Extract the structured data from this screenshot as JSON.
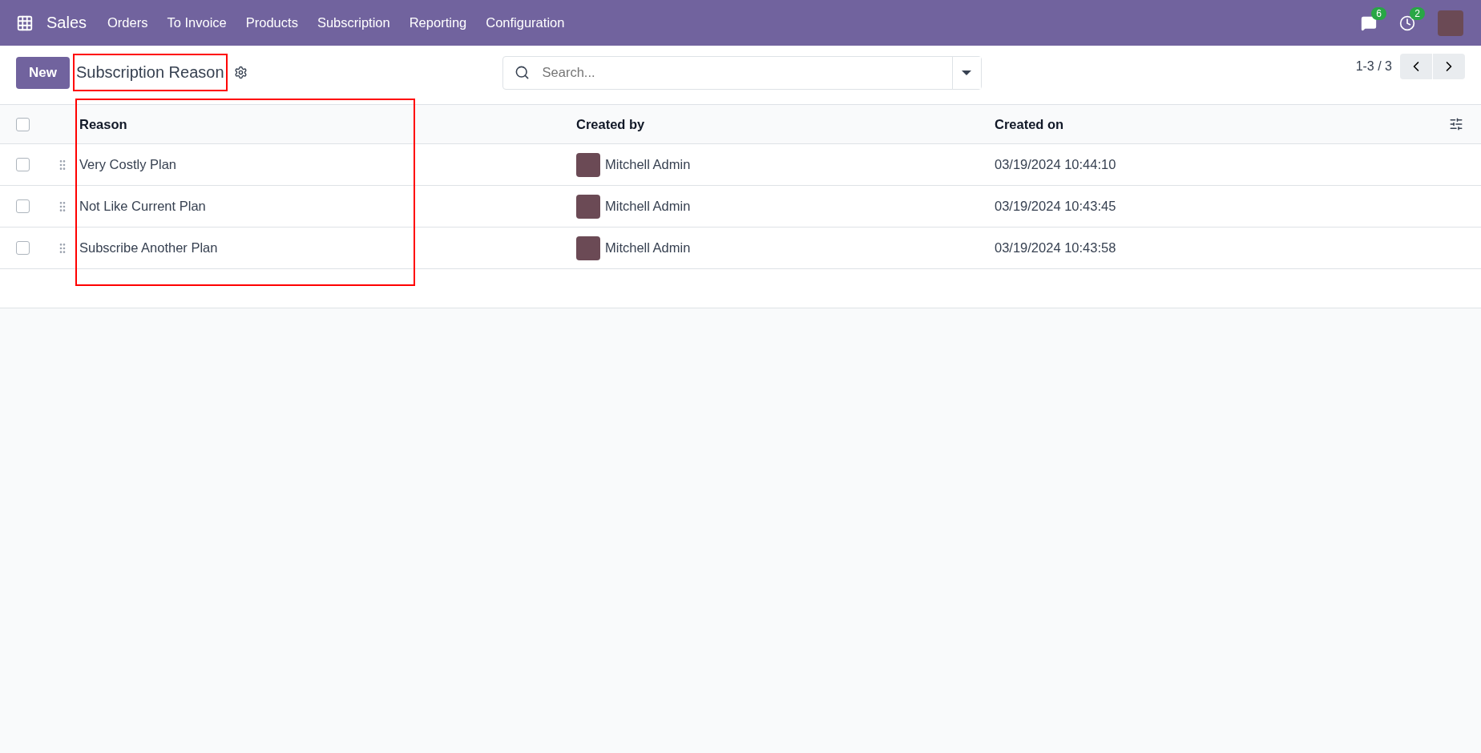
{
  "navbar": {
    "app": "Sales",
    "menu": [
      "Orders",
      "To Invoice",
      "Products",
      "Subscription",
      "Reporting",
      "Configuration"
    ],
    "messages_count": "6",
    "activities_count": "2"
  },
  "control_panel": {
    "new_button": "New",
    "title": "Subscription Reason",
    "title_highlighted": true,
    "search": {
      "placeholder": "Search..."
    },
    "pager": "1-3 / 3"
  },
  "table": {
    "reason_column_highlighted": true,
    "columns": [
      "Reason",
      "Created by",
      "Created on"
    ],
    "all_selected": false,
    "rows": [
      {
        "reason": "Very Costly Plan",
        "created_by": "Mitchell Admin",
        "created_on": "03/19/2024 10:44:10",
        "selected": false
      },
      {
        "reason": "Not Like Current Plan",
        "created_by": "Mitchell Admin",
        "created_on": "03/19/2024 10:43:45",
        "selected": false
      },
      {
        "reason": "Subscribe Another Plan",
        "created_by": "Mitchell Admin",
        "created_on": "03/19/2024 10:43:58",
        "selected": false
      }
    ]
  }
}
